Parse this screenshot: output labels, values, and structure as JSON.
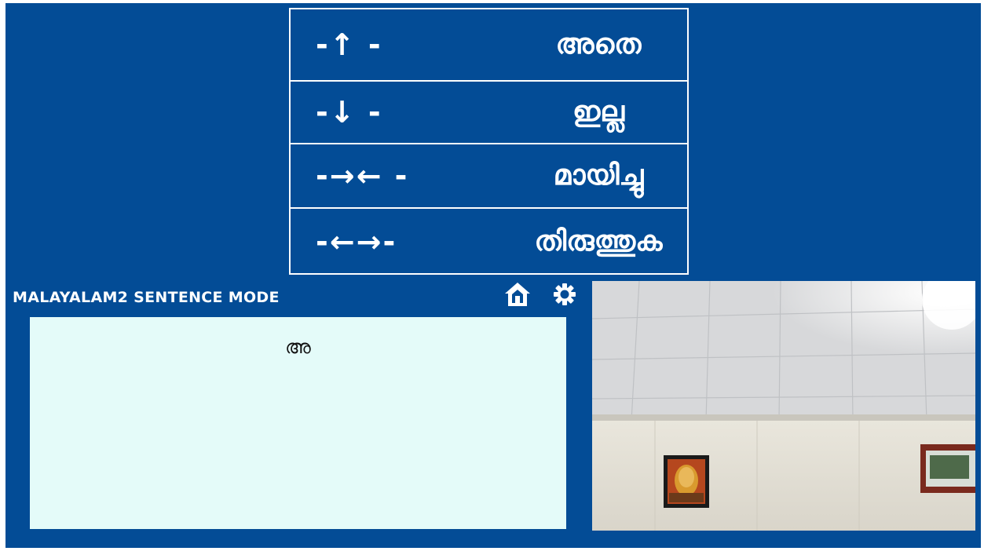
{
  "commands": [
    {
      "gesture": "-↑ -",
      "word": "അതെ"
    },
    {
      "gesture": "-↓ -",
      "word": "ഇല്ല"
    },
    {
      "gesture": "-→← -",
      "word": "മായിച്ചു"
    },
    {
      "gesture": "-←→-",
      "word": "തിരുത്തുക"
    }
  ],
  "mode_title": "MALAYALAM2 SENTENCE MODE",
  "typed_text": "അ",
  "toolbar_icons": [
    "home-icon",
    "gear-icon"
  ],
  "colors": {
    "background": "#034c96",
    "text_area": "#e4fbf9",
    "foreground": "#ffffff"
  }
}
